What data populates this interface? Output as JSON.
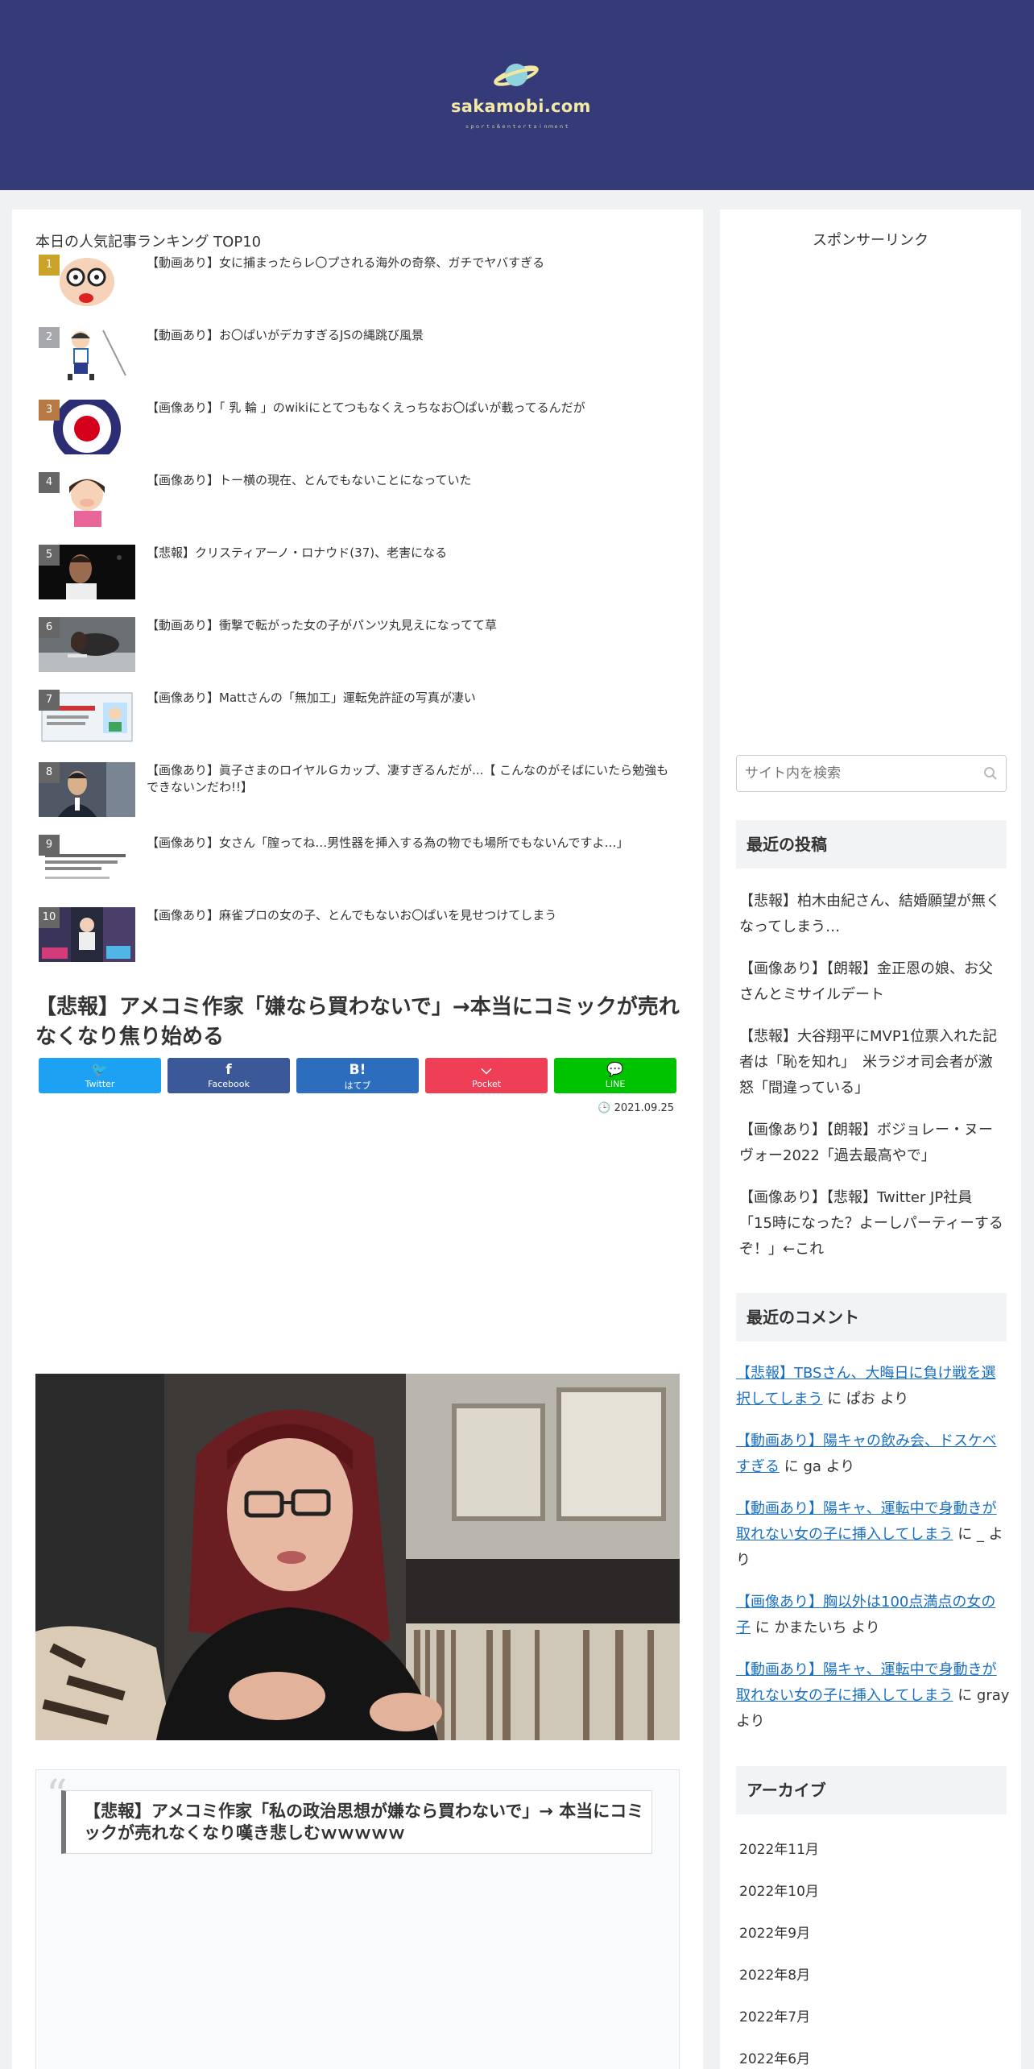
{
  "site": {
    "name": "sakamobi.com",
    "tagline": "ｓｐｏｒｔｓ＆ｅｎｔｅｒｔａｉｎｍｅｎｔ",
    "brand_color": "#353b78"
  },
  "ranking": {
    "title": "本日の人気記事ランキング TOP10",
    "items": [
      {
        "num": "1",
        "text": "【動画あり】女に捕まったらレ〇プされる海外の奇祭、ガチでヤバすぎる",
        "num_color": "#c9a227"
      },
      {
        "num": "2",
        "text": "【動画あり】お〇ぱいがデカすぎるJSの縄跳び風景",
        "num_color": "#a6a8ab"
      },
      {
        "num": "3",
        "text": "【画像あり】「 乳 輪 」のwikiにとてつもなくえっちなお〇ぱいが載ってるんだが",
        "num_color": "#b87a45"
      },
      {
        "num": "4",
        "text": "【画像あり】トー横の現在、とんでもないことになっていた",
        "num_color": "#666666"
      },
      {
        "num": "5",
        "text": "【悲報】クリスティアーノ・ロナウド(37)、老害になる",
        "num_color": "#666666"
      },
      {
        "num": "6",
        "text": "【動画あり】衝撃で転がった女の子がパンツ丸見えになってて草",
        "num_color": "#666666"
      },
      {
        "num": "7",
        "text": "【画像あり】Mattさんの「無加工」運転免許証の写真が凄い",
        "num_color": "#666666"
      },
      {
        "num": "8",
        "text": "【画像あり】眞子さまのロイヤルＧカップ、凄すぎるんだが...【 こんなのがそばにいたら勉強もできないンだわ!!】",
        "num_color": "#666666"
      },
      {
        "num": "9",
        "text": "【画像あり】女さん「膣ってね…男性器を挿入する為の物でも場所でもないんですよ…」",
        "num_color": "#666666"
      },
      {
        "num": "10",
        "text": "【画像あり】麻雀プロの女の子、とんでもないお〇ぱいを見せつけてしまう",
        "num_color": "#666666"
      }
    ]
  },
  "article": {
    "title": "【悲報】アメコミ作家「嫌なら買わないで」→本当にコミックが売れなくなり焦り始める",
    "date": "2021.09.25",
    "quote": "【悲報】アメコミ作家「私の政治思想が嫌なら買わないで」→ 本当にコミックが売れなくなり嘆き悲しむｗｗｗｗｗ"
  },
  "share": {
    "twitter": {
      "label": "Twitter",
      "color": "#1da1f2"
    },
    "facebook": {
      "label": "Facebook",
      "color": "#3b5998"
    },
    "hatebu": {
      "label": "はてブ",
      "glyph": "B!",
      "color": "#2c6ebd"
    },
    "pocket": {
      "label": "Pocket",
      "color": "#ef3f56"
    },
    "line": {
      "label": "LINE",
      "color": "#00c300"
    }
  },
  "sidebar": {
    "sponsor_label": "スポンサーリンク",
    "search_placeholder": "サイト内を検索",
    "recent_posts_title": "最近の投稿",
    "recent_posts": [
      "【悲報】柏木由紀さん、結婚願望が無くなってしまう…",
      "【画像あり】【朗報】金正恩の娘、お父さんとミサイルデート",
      "【悲報】大谷翔平にMVP1位票入れた記者は「恥を知れ」　米ラジオ司会者が激怒「間違っている」",
      "【画像あり】【朗報】ボジョレー・ヌーヴォー2022「過去最高やで」",
      "【画像あり】【悲報】Twitter JP社員「15時になった？よーしパーティーするぞ！」←これ"
    ],
    "recent_comments_title": "最近のコメント",
    "recent_comments": [
      {
        "link": "【悲報】TBSさん、大晦日に負け戦を選択してしまう",
        "by": " に ぱお より"
      },
      {
        "link": "【動画あり】陽キャの飲み会、ドスケベすぎる",
        "by": " に ga より"
      },
      {
        "link": "【動画あり】陽キャ、運転中で身動きが取れない女の子に挿入してしまう",
        "by": " に _ より"
      },
      {
        "link": "【画像あり】胸以外は100点満点の女の子",
        "by": " に かまたいち より"
      },
      {
        "link": "【動画あり】陽キャ、運転中で身動きが取れない女の子に挿入してしまう",
        "by": " に gray より"
      }
    ],
    "archive_title": "アーカイブ",
    "archives": [
      "2022年11月",
      "2022年10月",
      "2022年9月",
      "2022年8月",
      "2022年7月",
      "2022年6月"
    ]
  }
}
